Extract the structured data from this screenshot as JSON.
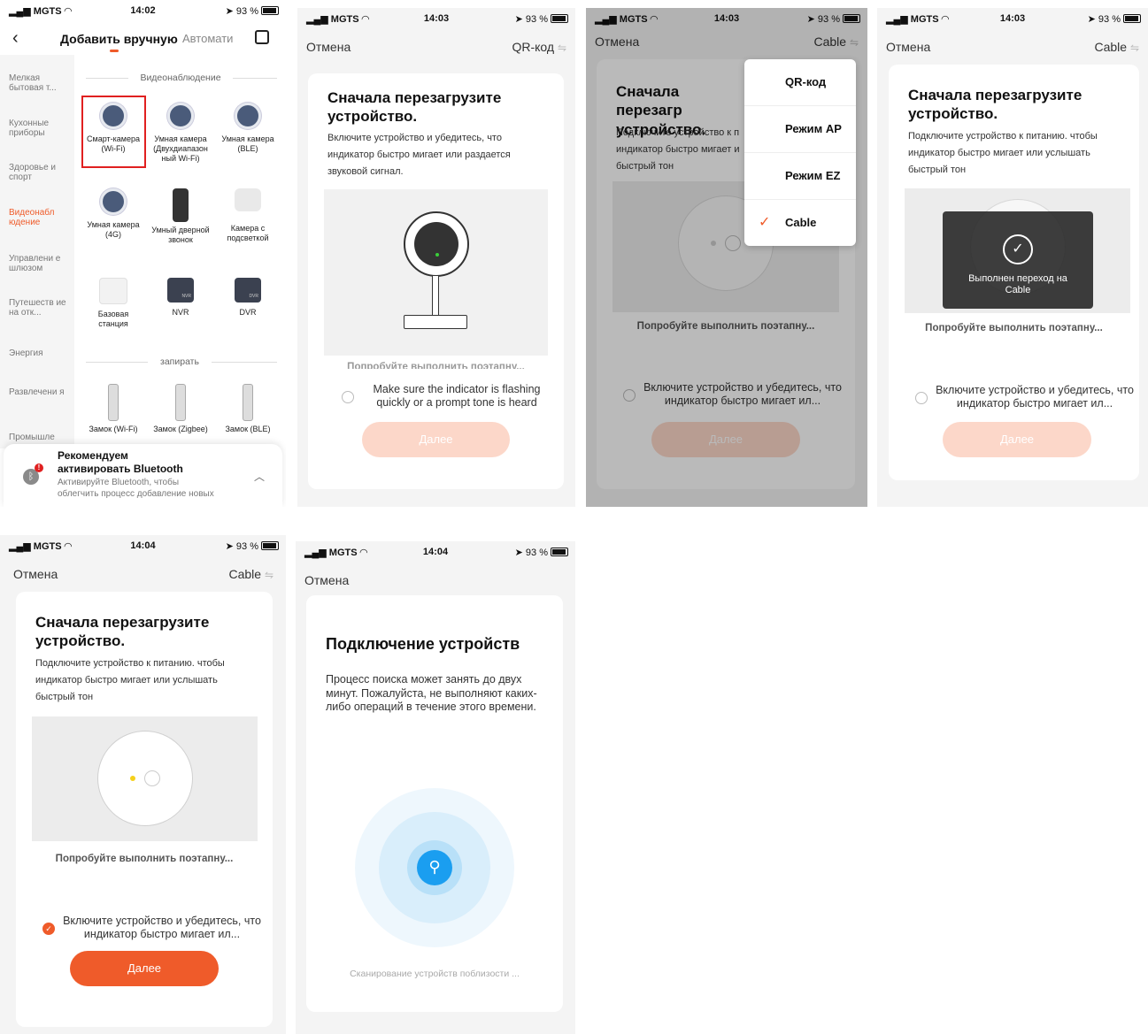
{
  "status_bar": {
    "carrier": "MGTS",
    "battery": "93 %",
    "times": [
      "14:02",
      "14:03",
      "14:03",
      "14:03",
      "14:04",
      "14:04"
    ]
  },
  "screen1": {
    "nav": {
      "tab_active": "Добавить вручную",
      "tab_other": "Автомати"
    },
    "sidebar": [
      "Мелкая бытовая т...",
      "Кухонные приборы",
      "Здоровье и спорт",
      "Видеонабл юдение",
      "Управлени е шлюзом",
      "Путешеств ие на отк...",
      "Энергия",
      "Развлечени я",
      "Промышле"
    ],
    "section1": "Видеонаблюдение",
    "devices": [
      "Смарт-камера (Wi-Fi)",
      "Умная камера (Двухдиапазон ный Wi-Fi)",
      "Умная камера (BLE)",
      "Умная камера (4G)",
      "Умный дверной звонок",
      "Камера с подсветкой",
      "Базовая станция",
      "NVR",
      "DVR"
    ],
    "nvr_box": "NVR",
    "dvr_box": "DVR",
    "section2": "запирать",
    "locks": [
      "Замок (Wi-Fi)",
      "Замок (Zigbee)",
      "Замок (BLE)"
    ],
    "banner": {
      "title1": "Рекомендуем",
      "title2": "активировать Bluetooth",
      "text1": "Активируйте Bluetooth, чтобы",
      "text2": "облегчить процесс добавление новых"
    }
  },
  "common": {
    "cancel": "Отмена",
    "heading": "Сначала перезагрузите устройство.",
    "next": "Далее",
    "stepwise": "Попробуйте выполнить поэтапну...",
    "confirm": "Включите устройство и убедитесь, что индикатор быстро мигает ил..."
  },
  "screen2": {
    "mode": "QR-код",
    "desc": "Включите устройство и убедитесь, что индикатор быстро мигает или раздается звуковой сигнал.",
    "stepwise_cut": "Попробуйте выполнить поэтапну...",
    "confirm": "Make sure the indicator is flashing quickly or a prompt tone is heard"
  },
  "screen3": {
    "mode": "Cable",
    "heading": "Сначала перезагр устройство.",
    "desc1": "Подключите устройство к п",
    "desc2": "индикатор быстро мигает и",
    "desc3": "быстрый тон",
    "menu": [
      "QR-код",
      "Режим AP",
      "Режим EZ",
      "Cable"
    ],
    "menu_selected": "Cable"
  },
  "screen4": {
    "mode": "Cable",
    "desc": "Подключите устройство к питанию. чтобы индикатор быстро мигает или услышать быстрый тон",
    "toast": "Выполнен переход на Cable"
  },
  "screen5": {
    "mode": "Cable",
    "desc": "Подключите устройство к питанию. чтобы индикатор быстро мигает или услышать быстрый тон"
  },
  "screen6": {
    "title": "Подключение устройств",
    "desc": "Процесс поиска может занять до двух минут. Пожалуйста, не выполняют каких-либо операций в течение этого времени.",
    "scanning": "Сканирование устройств поблизости ..."
  }
}
